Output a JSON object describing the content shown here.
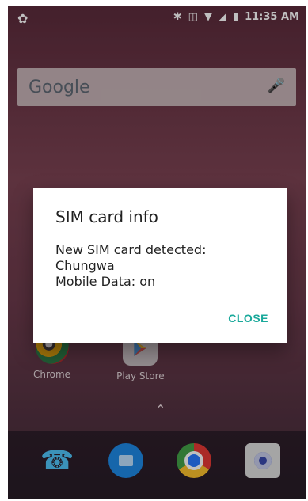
{
  "status_bar": {
    "time": "11:35 AM"
  },
  "search": {
    "logo": "Google"
  },
  "apps": [
    {
      "label": "Chrome"
    },
    {
      "label": "Play Store"
    }
  ],
  "dialog": {
    "title": "SIM card info",
    "line1": "New SIM card detected:",
    "line2": "Chungwa",
    "line3": "Mobile Data: on",
    "button": "CLOSE"
  },
  "icons": {
    "search_icon": "mic-icon",
    "status_left": "app-notification-icon",
    "status_right": [
      "bluetooth-icon",
      "vibrate-icon",
      "wifi-icon",
      "signal-icon",
      "battery-icon"
    ],
    "dock": [
      "phone-icon",
      "messages-icon",
      "chrome-icon",
      "camera-icon"
    ]
  }
}
